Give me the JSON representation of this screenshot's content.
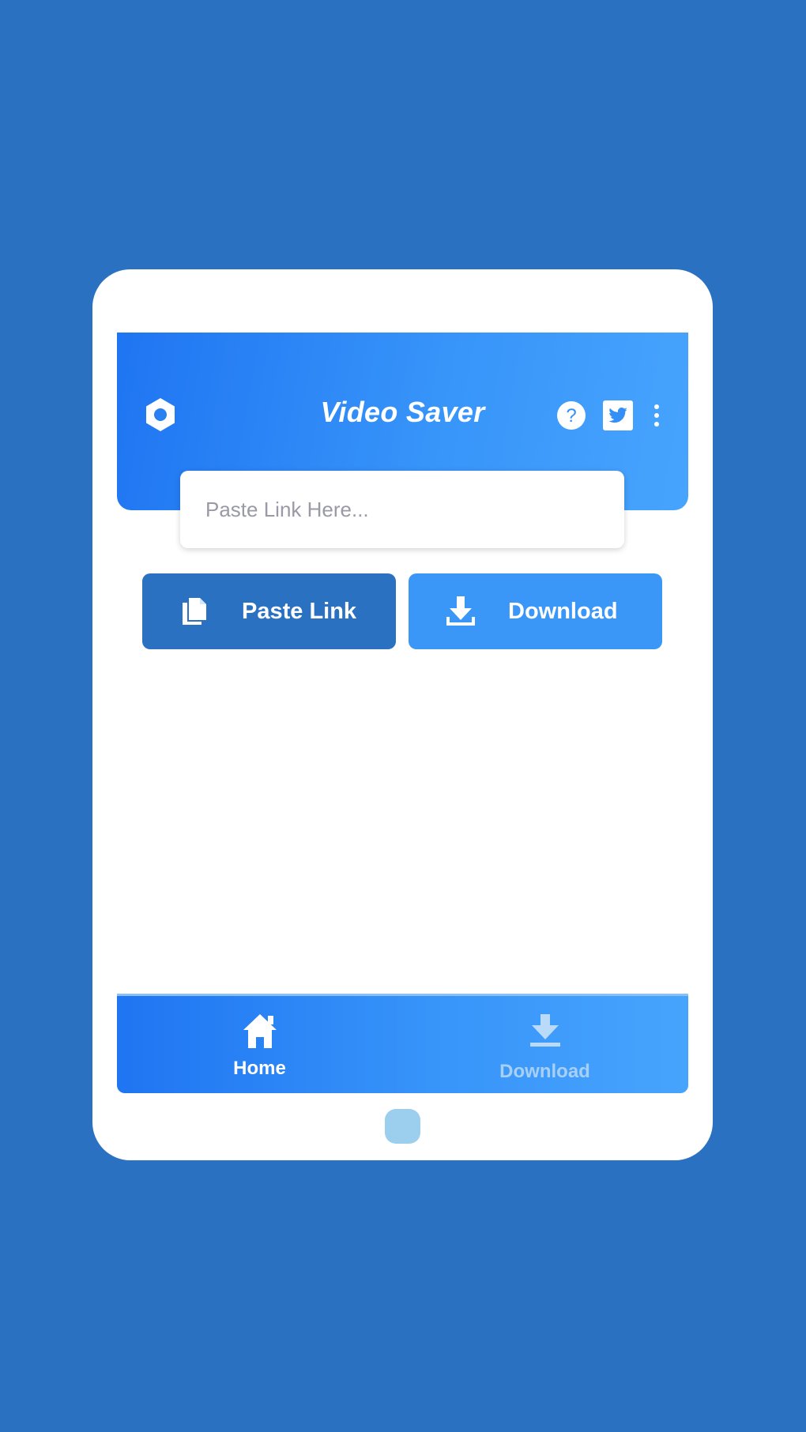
{
  "colors": {
    "background": "#2b71c2",
    "appbar_start": "#1f75f2",
    "appbar_end": "#47a4fd",
    "paste_button": "#2b71c2",
    "download_button": "#3a97f7",
    "inactive_tab": "#a8d0f7",
    "home_button": "#9ccfee"
  },
  "appbar": {
    "title": "Video Saver",
    "left_icon": "settings-hex-icon",
    "right_icons": [
      "help-icon",
      "twitter-icon",
      "more-vert-icon"
    ]
  },
  "link_input": {
    "placeholder": "Paste Link Here...",
    "value": ""
  },
  "buttons": {
    "paste_label": "Paste Link",
    "paste_icon": "copy-icon",
    "download_label": "Download",
    "download_icon": "download-icon"
  },
  "bottom_nav": {
    "items": [
      {
        "label": "Home",
        "icon": "home-icon",
        "active": true
      },
      {
        "label": "Download",
        "icon": "download-icon",
        "active": false
      }
    ]
  }
}
